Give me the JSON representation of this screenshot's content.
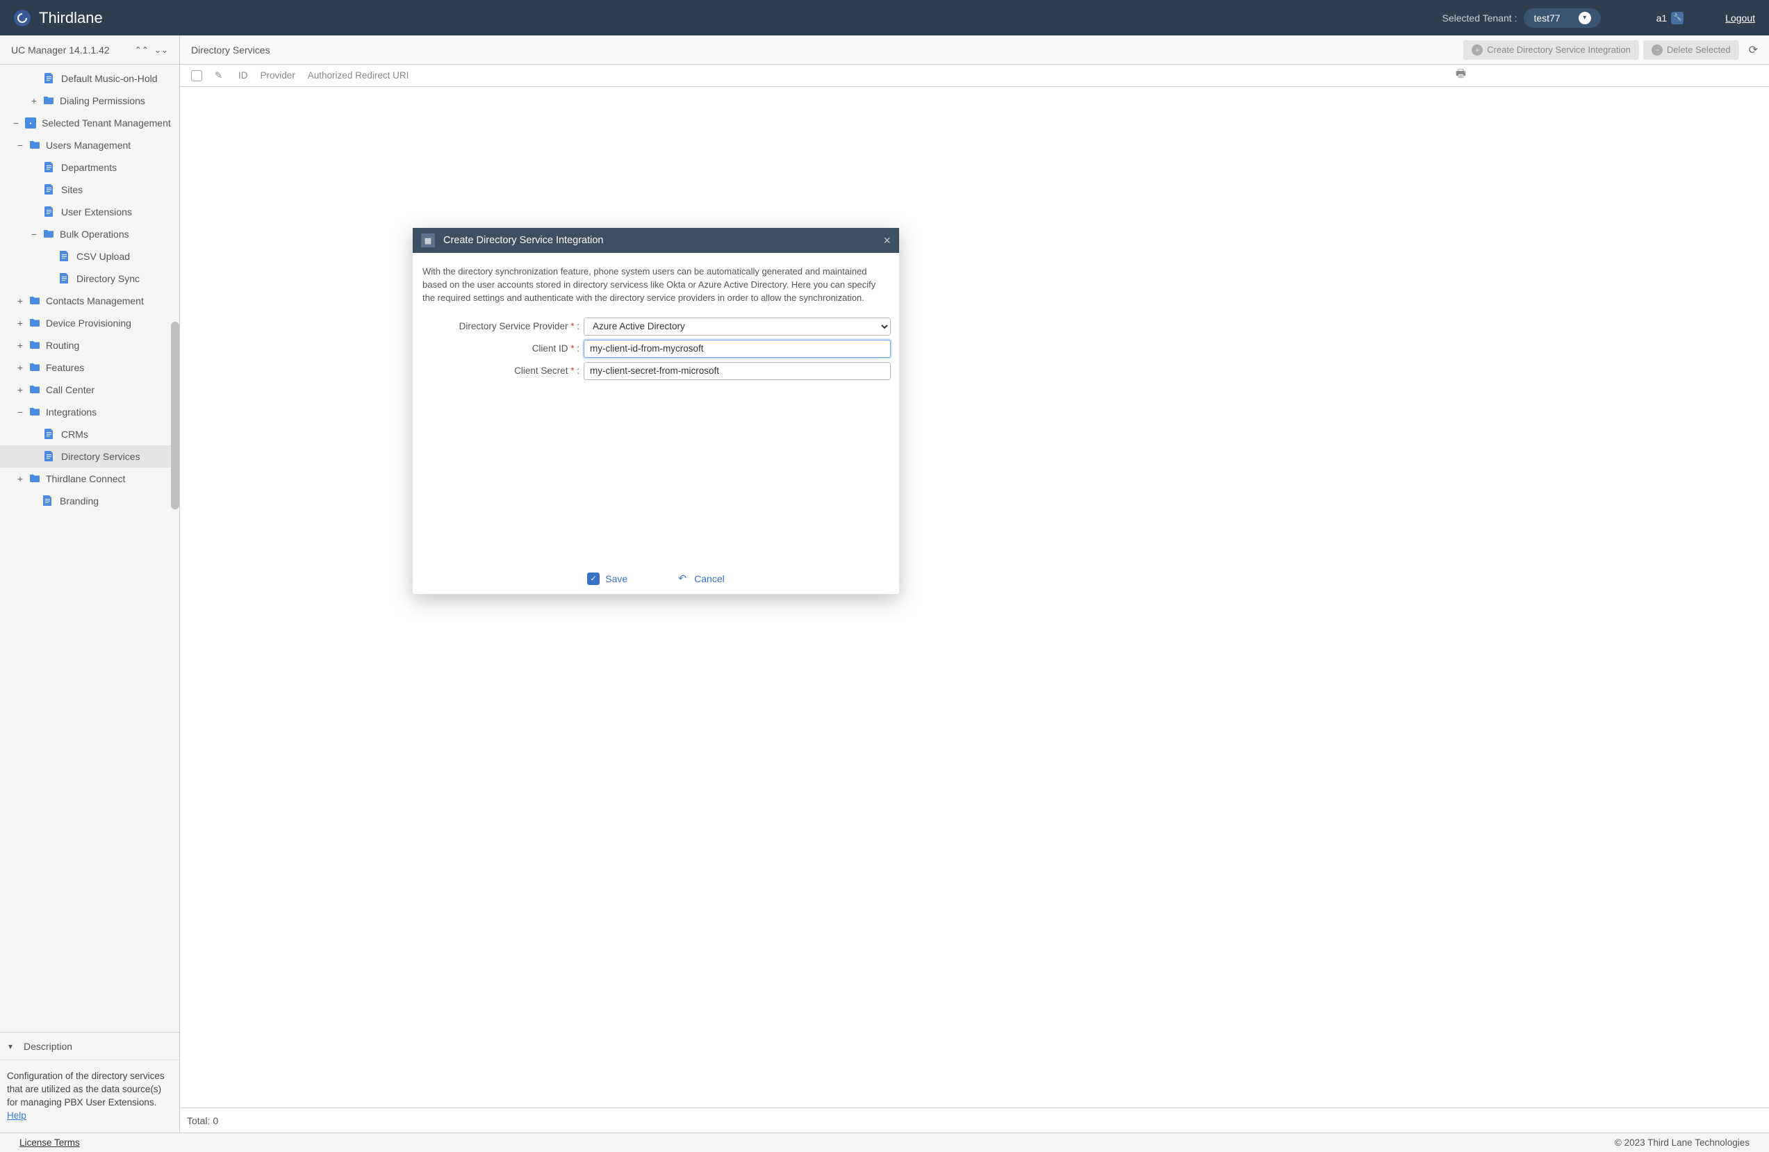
{
  "header": {
    "brand": "Thirdlane",
    "tenant_label": "Selected Tenant :",
    "tenant_value": "test77",
    "user": "a1",
    "logout": "Logout"
  },
  "sidebar": {
    "title": "UC Manager 14.1.1.42",
    "items": [
      {
        "label": "Default Music-on-Hold",
        "type": "page",
        "indent": 3
      },
      {
        "label": "Dialing Permissions",
        "type": "folder",
        "indent": 2,
        "toggle": "+"
      },
      {
        "label": "Selected Tenant Management",
        "type": "special",
        "indent": 0,
        "toggle": "−"
      },
      {
        "label": "Users Management",
        "type": "folder",
        "indent": 1,
        "toggle": "−"
      },
      {
        "label": "Departments",
        "type": "page",
        "indent": 3
      },
      {
        "label": "Sites",
        "type": "page",
        "indent": 3
      },
      {
        "label": "User Extensions",
        "type": "page",
        "indent": 3
      },
      {
        "label": "Bulk Operations",
        "type": "folder",
        "indent": 2,
        "toggle": "−"
      },
      {
        "label": "CSV Upload",
        "type": "page",
        "indent": 4
      },
      {
        "label": "Directory Sync",
        "type": "page",
        "indent": 4
      },
      {
        "label": "Contacts Management",
        "type": "folder",
        "indent": 1,
        "toggle": "+"
      },
      {
        "label": "Device Provisioning",
        "type": "folder",
        "indent": 1,
        "toggle": "+"
      },
      {
        "label": "Routing",
        "type": "folder",
        "indent": 1,
        "toggle": "+"
      },
      {
        "label": "Features",
        "type": "folder",
        "indent": 1,
        "toggle": "+"
      },
      {
        "label": "Call Center",
        "type": "folder",
        "indent": 1,
        "toggle": "+"
      },
      {
        "label": "Integrations",
        "type": "folder",
        "indent": 1,
        "toggle": "−"
      },
      {
        "label": "CRMs",
        "type": "page",
        "indent": 3
      },
      {
        "label": "Directory Services",
        "type": "page",
        "indent": 3,
        "active": true
      },
      {
        "label": "Thirdlane Connect",
        "type": "folder",
        "indent": 1,
        "toggle": "+"
      },
      {
        "label": "Branding",
        "type": "page",
        "indent": 2
      }
    ],
    "desc_title": "Description",
    "desc_body": "Configuration of the directory services that are utilized as the data source(s) for managing PBX User Extensions.",
    "help_label": "Help"
  },
  "content": {
    "title": "Directory Services",
    "create_btn": "Create Directory Service Integration",
    "delete_btn": "Delete Selected",
    "columns": {
      "id": "ID",
      "provider": "Provider",
      "uri": "Authorized Redirect URI"
    },
    "total_label": "Total: 0"
  },
  "modal": {
    "title": "Create Directory Service Integration",
    "desc": "With the directory synchronization feature, phone system users can be automatically generated and maintained based on the user accounts stored in directory servicess like Okta or Azure Active Directory. Here you can specify the required settings and authenticate with the directory service providers in order to allow the synchronization.",
    "fields": {
      "provider_label": "Directory Service Provider",
      "provider_value": "Azure Active Directory",
      "client_id_label": "Client ID",
      "client_id_value": "my-client-id-from-mycrosoft",
      "client_secret_label": "Client Secret",
      "client_secret_value": "my-client-secret-from-microsoft"
    },
    "save": "Save",
    "cancel": "Cancel"
  },
  "footer": {
    "license": "License Terms",
    "copyright": "© 2023 Third Lane Technologies"
  }
}
